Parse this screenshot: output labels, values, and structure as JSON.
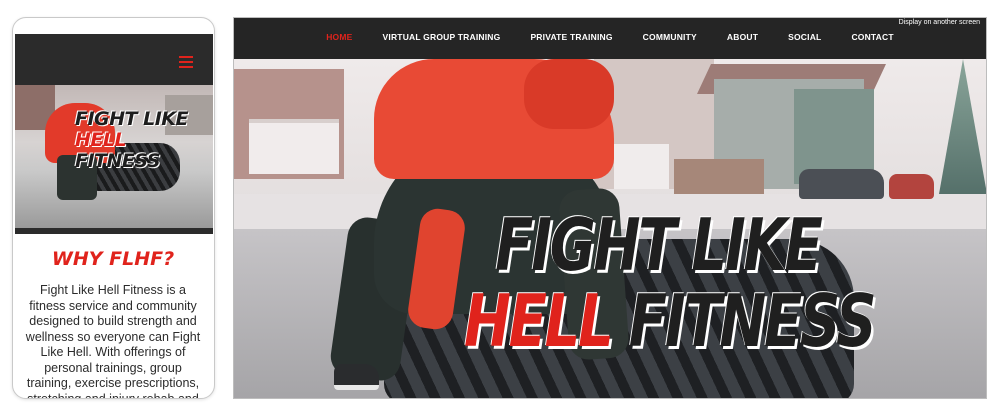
{
  "mobile": {
    "menu_icon": "hamburger-icon",
    "hero_title": {
      "line1": "FIGHT LIKE",
      "line2_red": "HELL",
      "line2_dark": "FITNESS"
    },
    "section_heading": "WHY FLHF?",
    "body_text": "Fight Like Hell Fitness is a fitness service and community designed to build strength and wellness so everyone can Fight Like Hell. With offerings of personal trainings, group training, exercise prescriptions, stretching and injury rehab and prevention",
    "colors": {
      "accent": "#e0231c",
      "header": "#2b2b2b"
    }
  },
  "desktop": {
    "nav": {
      "items": [
        {
          "label": "HOME",
          "active": true
        },
        {
          "label": "VIRTUAL GROUP TRAINING",
          "active": false
        },
        {
          "label": "PRIVATE TRAINING",
          "active": false
        },
        {
          "label": "COMMUNITY",
          "active": false
        },
        {
          "label": "ABOUT",
          "active": false
        },
        {
          "label": "SOCIAL",
          "active": false
        },
        {
          "label": "CONTACT",
          "active": false
        }
      ]
    },
    "external_display_label": "Display on another screen",
    "hero_title": {
      "line1": "FIGHT LIKE",
      "line2_red": "HELL",
      "line2_dark": "FITNESS"
    },
    "colors": {
      "accent": "#e0231c",
      "nav_bg": "#252525"
    }
  }
}
